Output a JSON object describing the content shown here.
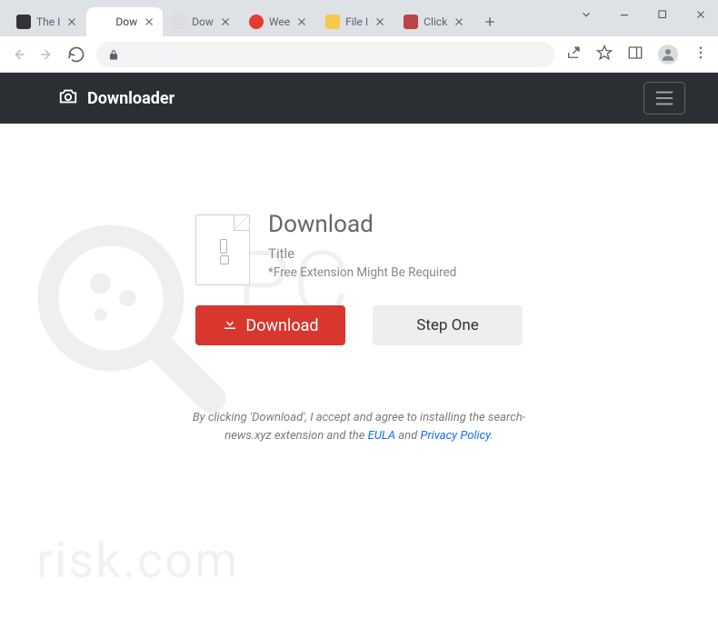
{
  "window": {
    "tabs": [
      {
        "label": "The I",
        "active": false
      },
      {
        "label": "Dow",
        "active": true
      },
      {
        "label": "Dow",
        "active": false
      },
      {
        "label": "Wee",
        "active": false
      },
      {
        "label": "File I",
        "active": false
      },
      {
        "label": "Click",
        "active": false
      }
    ]
  },
  "site": {
    "brand": "Downloader"
  },
  "download": {
    "heading": "Download",
    "title": "Title",
    "note": "*Free Extension Might Be Required",
    "buttonDownload": "Download",
    "buttonStep": "Step One"
  },
  "disclaimer": {
    "prefix": "By clicking 'Download', I accept and agree to installing the search-news.xyz extension and the ",
    "eula": "EULA",
    "and": " and ",
    "privacy": "Privacy Policy",
    "dot": "."
  },
  "watermark": {
    "big": "PC",
    "small": "risk.com"
  }
}
